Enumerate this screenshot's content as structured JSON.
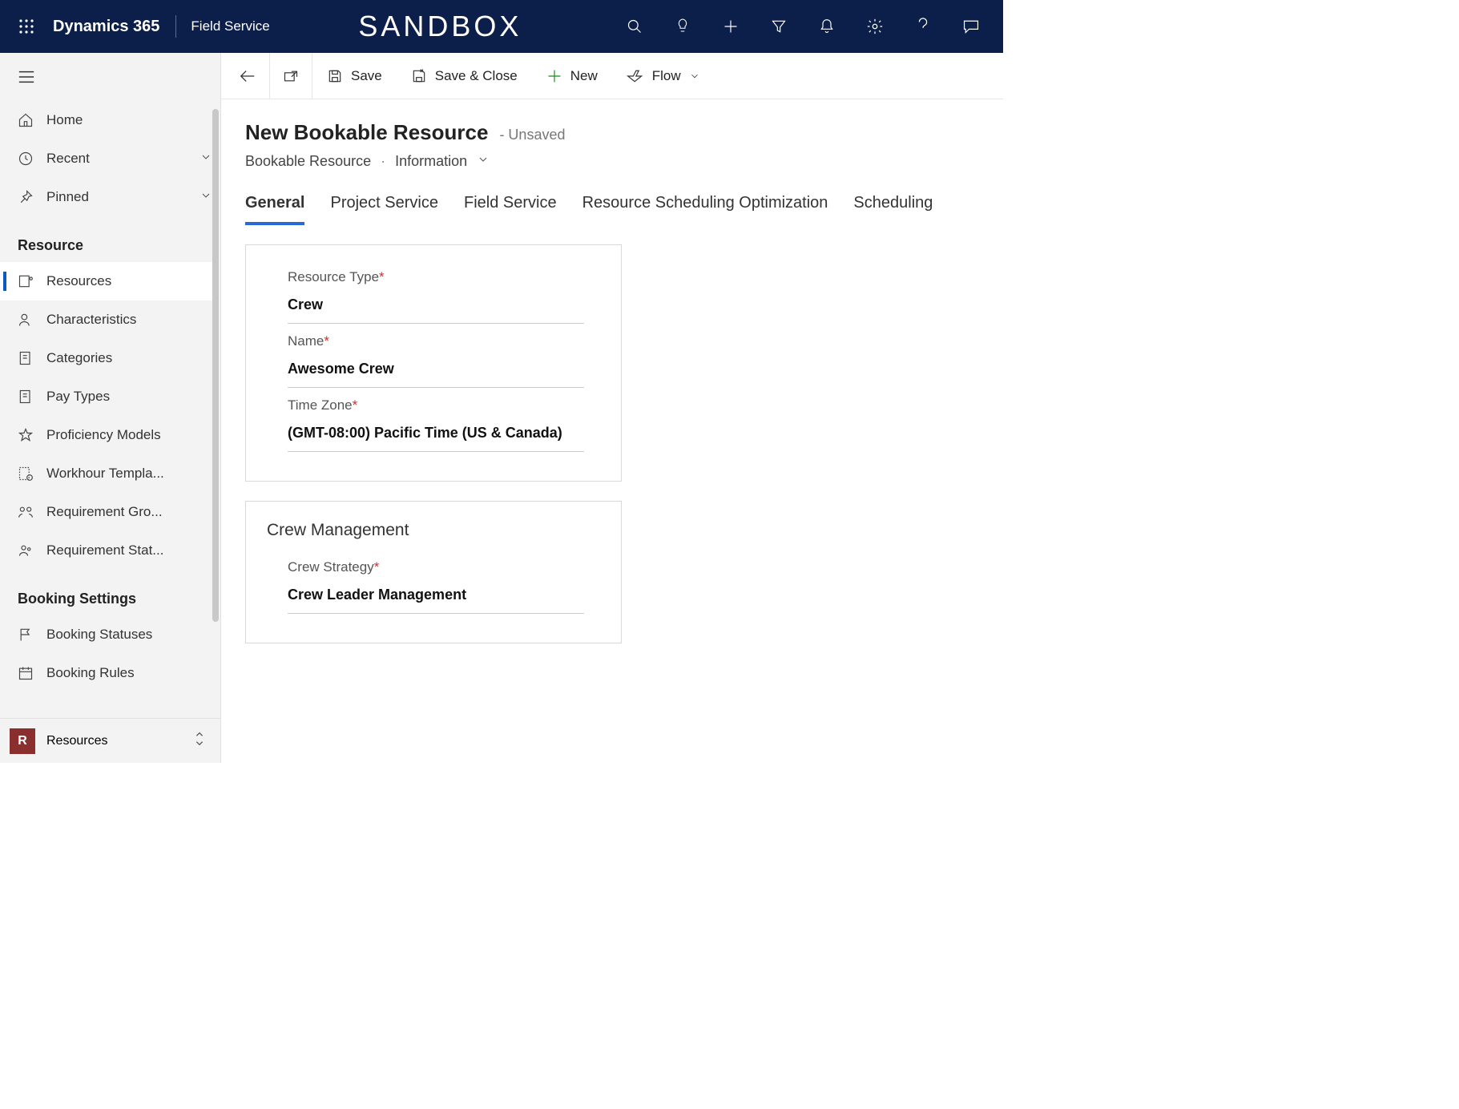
{
  "topbar": {
    "brand": "Dynamics 365",
    "app": "Field Service",
    "env": "SANDBOX"
  },
  "sidebar": {
    "top": [
      {
        "label": "Home",
        "chevron": false
      },
      {
        "label": "Recent",
        "chevron": true
      },
      {
        "label": "Pinned",
        "chevron": true
      }
    ],
    "sections": [
      {
        "heading": "Resource",
        "items": [
          {
            "label": "Resources",
            "selected": true
          },
          {
            "label": "Characteristics"
          },
          {
            "label": "Categories"
          },
          {
            "label": "Pay Types"
          },
          {
            "label": "Proficiency Models"
          },
          {
            "label": "Workhour Templa..."
          },
          {
            "label": "Requirement Gro..."
          },
          {
            "label": "Requirement Stat..."
          }
        ]
      },
      {
        "heading": "Booking Settings",
        "items": [
          {
            "label": "Booking Statuses"
          },
          {
            "label": "Booking Rules"
          }
        ]
      }
    ],
    "area": {
      "initial": "R",
      "label": "Resources"
    }
  },
  "cmdbar": {
    "save": "Save",
    "save_close": "Save & Close",
    "new": "New",
    "flow": "Flow"
  },
  "page": {
    "title": "New Bookable Resource",
    "state": "- Unsaved",
    "entity": "Bookable Resource",
    "form": "Information"
  },
  "tabs": [
    "General",
    "Project Service",
    "Field Service",
    "Resource Scheduling Optimization",
    "Scheduling"
  ],
  "general": {
    "fields": [
      {
        "label": "Resource Type",
        "required": true,
        "value": "Crew"
      },
      {
        "label": "Name",
        "required": true,
        "value": "Awesome Crew"
      },
      {
        "label": "Time Zone",
        "required": true,
        "value": "(GMT-08:00) Pacific Time (US & Canada)"
      }
    ]
  },
  "crew": {
    "heading": "Crew Management",
    "fields": [
      {
        "label": "Crew Strategy",
        "required": true,
        "value": "Crew Leader Management"
      }
    ]
  }
}
